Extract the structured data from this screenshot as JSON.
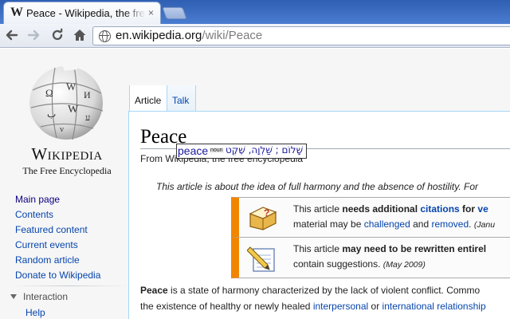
{
  "browser": {
    "tab_title": "Peace - Wikipedia, the free encyclopedia",
    "tab_favicon": "W",
    "tab_close": "×",
    "url_host": "en.wikipedia.org",
    "url_path": "/wiki/Peace",
    "icons": {
      "back": "arrow-left-icon",
      "forward": "arrow-right-icon",
      "reload": "reload-icon",
      "home": "home-icon",
      "site": "globe-icon"
    }
  },
  "wiki": {
    "wordmark": "Wikipedia",
    "tagline": "The Free Encyclopedia",
    "nav": [
      "Main page",
      "Contents",
      "Featured content",
      "Current events",
      "Random article",
      "Donate to Wikipedia"
    ],
    "section": "Interaction",
    "section_item": "Help",
    "tabs": {
      "article": "Article",
      "talk": "Talk"
    },
    "title": "Peace",
    "site_sub": "From Wikipedia, the free encyclopedia",
    "hatnote": "This article is about the idea of full harmony and the absence of hostility. For",
    "notice1": {
      "pre": "This article ",
      "bold": "needs additional ",
      "link": "citations",
      "after": " for ",
      "link2": "ve",
      "line2_pre": "material may be ",
      "line2_link1": "challenged",
      "line2_mid": " and ",
      "line2_link2": "removed",
      "line2_end": ". ",
      "date": "(Janu"
    },
    "notice2": {
      "pre": "This article ",
      "bold": "may need to be rewritten entirel",
      "line2": "contain suggestions. ",
      "date": "(May 2009)"
    },
    "para": {
      "lead": "Peace",
      "l1": " is a state of harmony characterized by the lack of violent conflict. Commo",
      "l2_pre": "the existence of healthy or newly healed ",
      "l2_link1": "interpersonal",
      "l2_mid": " or ",
      "l2_link2": "international relationship"
    }
  },
  "popup": {
    "word": "peace",
    "pos": "noun",
    "definition": "שָׁלוֹם ; שַׁלְוָה, שֶׁקֶט"
  },
  "colors": {
    "ambox_border": "#f28500",
    "link": "#0645ad",
    "tab_border": "#a7d7f9"
  }
}
